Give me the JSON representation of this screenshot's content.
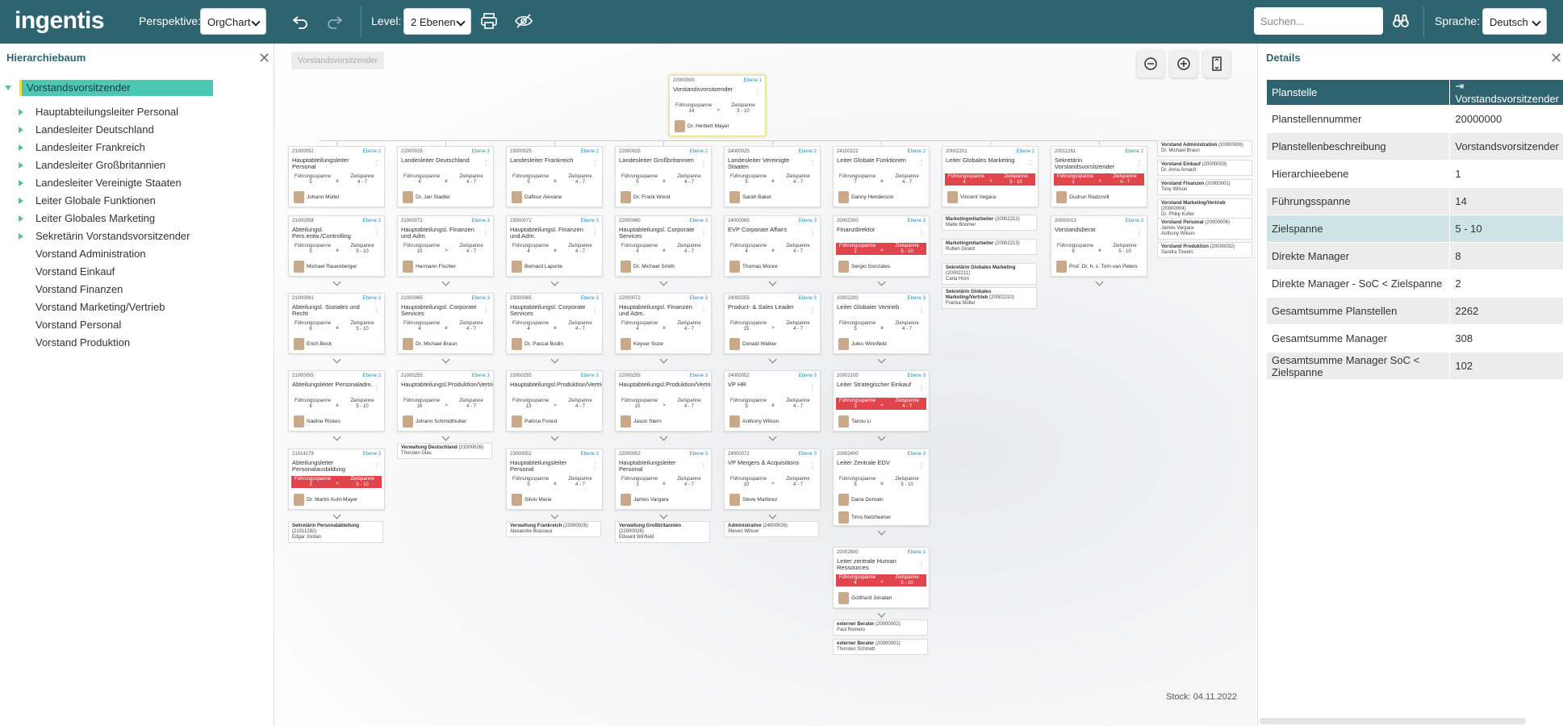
{
  "topbar": {
    "logo": "ingentis",
    "perspective_label": "Perspektive:",
    "perspective_value": "OrgChart",
    "level_label": "Level:",
    "level_value": "2 Ebenen",
    "search_placeholder": "Suchen...",
    "language_label": "Sprache:",
    "language_value": "Deutsch",
    "bg_color": "#2e6470"
  },
  "left_panel": {
    "title": "Hierarchiebaum",
    "root": "Vorstandsvorsitzender",
    "items": [
      {
        "label": "Hauptabteilungsleiter Personal",
        "expandable": true
      },
      {
        "label": "Landesleiter Deutschland",
        "expandable": true
      },
      {
        "label": "Landesleiter Frankreich",
        "expandable": true
      },
      {
        "label": "Landesleiter Großbritannien",
        "expandable": true
      },
      {
        "label": "Landesleiter Vereinigte Staaten",
        "expandable": true
      },
      {
        "label": "Leiter Globale Funktionen",
        "expandable": true
      },
      {
        "label": "Leiter Globales Marketing",
        "expandable": true
      },
      {
        "label": "Sekretärin Vorstandsvorsitzender",
        "expandable": true
      },
      {
        "label": "Vorstand Administration",
        "expandable": false
      },
      {
        "label": "Vorstand Einkauf",
        "expandable": false
      },
      {
        "label": "Vorstand Finanzen",
        "expandable": false
      },
      {
        "label": "Vorstand Marketing/Vertrieb",
        "expandable": false
      },
      {
        "label": "Vorstand Personal",
        "expandable": false
      },
      {
        "label": "Vorstand Produktion",
        "expandable": false
      }
    ]
  },
  "canvas": {
    "breadcrumb": "Vorstandsvorsitzender",
    "stock": "Stock: 04.11.2022",
    "root_card": {
      "id": "20000000",
      "level": "Ebene 1",
      "title": "Vorstandsvorsitzender",
      "span_label": "Führungsspanne",
      "target_label": "Zielspanne",
      "span": "14",
      "op": ">",
      "target": "5 - 10",
      "person": "Dr. Herbert Mayer"
    },
    "columns": [
      {
        "cards": [
          {
            "id": "21000052",
            "level": "Ebene 2",
            "title": "Hauptabteilungsleiter Personal",
            "span": "5",
            "op": "e",
            "target": "4 - 7",
            "person": "Johann Müller",
            "red": false
          },
          {
            "id": "21000058",
            "level": "Ebene 3",
            "title": "Abteilungsl. Pers.entw./Controlling",
            "span": "5",
            "op": "e",
            "target": "5 - 10",
            "person": "Michael Rauenberger",
            "red": false
          },
          {
            "id": "21000061",
            "level": "Ebene 3",
            "title": "Abteilungsl. Soziales und Recht",
            "span": "6",
            "op": "e",
            "target": "5 - 10",
            "person": "Erich Beck",
            "red": false
          },
          {
            "id": "21000055",
            "level": "Ebene 3",
            "title": "Abteilungsleiter Personaladm.",
            "span": "8",
            "op": "e",
            "target": "5 - 10",
            "person": "Nadine Rickes",
            "red": false
          },
          {
            "id": "21014179",
            "level": "Ebene 3",
            "title": "Abteilungsleiter Personalausbildung",
            "span": "2",
            "op": "<",
            "target": "5 - 10",
            "person": "Dr. Martin Kuhl-Mayer",
            "red": true
          }
        ],
        "minis": [
          {
            "title": "Sekretärin Personalabteilung",
            "id": "(21011282)",
            "person": "Edgar Jordan"
          }
        ]
      },
      {
        "cards": [
          {
            "id": "21000025",
            "level": "Ebene 2",
            "title": "Landesleiter Deutschland",
            "span": "4",
            "op": "e",
            "target": "4 - 7",
            "person": "Dr. Jan Stadler",
            "red": false
          },
          {
            "id": "21000072",
            "level": "Ebene 3",
            "title": "Hauptabteilungsl. Finanzen und Adm.",
            "span": "10",
            "op": ">",
            "target": "4 - 7",
            "person": "Hermann Fischer",
            "red": false
          },
          {
            "id": "21000065",
            "level": "Ebene 3",
            "title": "Hauptabteilungsl. Corporate Services",
            "span": "4",
            "op": "e",
            "target": "4 - 7",
            "person": "Dr. Michael Braun",
            "red": false
          },
          {
            "id": "21000255",
            "level": "Ebene 3",
            "title": "Hauptabteilungsl.Produktion/Vertrieb",
            "span": "16",
            "op": ">",
            "target": "4 - 7",
            "person": "Johann Schmidthuber",
            "red": false
          }
        ],
        "minis": [
          {
            "title": "Verwaltung Deutschland",
            "id": "(21000026)",
            "person": "Thorsten Glas"
          }
        ]
      },
      {
        "cards": [
          {
            "id": "23000025",
            "level": "Ebene 2",
            "title": "Landesleiter Frankreich",
            "span": "5",
            "op": "e",
            "target": "4 - 7",
            "person": "Daftour Alexane",
            "red": false
          },
          {
            "id": "23000072",
            "level": "Ebene 3",
            "title": "Hauptabteilungsl. Finanzen und Adm.",
            "span": "4",
            "op": "e",
            "target": "4 - 7",
            "person": "Bernard Laporte",
            "red": false
          },
          {
            "id": "23000065",
            "level": "Ebene 3",
            "title": "Hauptabteilungsl. Corporate Services",
            "span": "4",
            "op": "e",
            "target": "4 - 7",
            "person": "Dr. Pascal Bodin",
            "red": false
          },
          {
            "id": "23000255",
            "level": "Ebene 3",
            "title": "Hauptabteilungsl.Produktion/Vertrieb",
            "span": "13",
            "op": ">",
            "target": "4 - 7",
            "person": "Patrice Forest",
            "red": false
          },
          {
            "id": "23000052",
            "level": "Ebene 3",
            "title": "Hauptabteilungsleiter Personal",
            "span": "5",
            "op": "e",
            "target": "4 - 7",
            "person": "Silvio Marie",
            "red": false
          }
        ],
        "minis": [
          {
            "title": "Verwaltung Frankreich",
            "id": "(23000026)",
            "person": "Alexandre Brasseur"
          }
        ]
      },
      {
        "cards": [
          {
            "id": "22000025",
            "level": "Ebene 2",
            "title": "Landesleiter Großbritannien",
            "span": "5",
            "op": "e",
            "target": "4 - 7",
            "person": "Dr. Frank Wood",
            "red": false
          },
          {
            "id": "22000060",
            "level": "Ebene 3",
            "title": "Hauptabteilungsl. Corporate Services",
            "span": "4",
            "op": "e",
            "target": "4 - 7",
            "person": "Dr. Michael Smith",
            "red": false
          },
          {
            "id": "22000072",
            "level": "Ebene 3",
            "title": "Hauptabteilungsl. Finanzen und Adm.",
            "span": "4",
            "op": "e",
            "target": "4 - 7",
            "person": "Keyser Soze",
            "red": false
          },
          {
            "id": "22000255",
            "level": "Ebene 3",
            "title": "Hauptabteilungsl.Produktion/Vertrieb",
            "span": "10",
            "op": ">",
            "target": "4 - 7",
            "person": "Jason Stern",
            "red": false
          },
          {
            "id": "22000052",
            "level": "Ebene 3",
            "title": "Hauptabteilungsleiter Personal",
            "span": "3",
            "op": "e",
            "target": "4 - 7",
            "person": "James Vargara",
            "red": false
          }
        ],
        "minis": [
          {
            "title": "Verwaltung Großbritannien",
            "id": "(22000026)",
            "person": "Edward Winfield"
          }
        ]
      },
      {
        "cards": [
          {
            "id": "24000025",
            "level": "Ebene 2",
            "title": "Landesleiter Vereinigte Staaten",
            "span": "5",
            "op": "e",
            "target": "4 - 7",
            "person": "Sarah Baker",
            "red": false
          },
          {
            "id": "24000065",
            "level": "Ebene 3",
            "title": "EVP Corporate Affairs",
            "span": "4",
            "op": "e",
            "target": "4 - 7",
            "person": "Thomas Moore",
            "red": false
          },
          {
            "id": "24000255",
            "level": "Ebene 3",
            "title": "Product- & Sales Leader",
            "span": "15",
            "op": ">",
            "target": "4 - 7",
            "person": "Donald Walker",
            "red": false
          },
          {
            "id": "24000052",
            "level": "Ebene 3",
            "title": "VP HR",
            "span": "5",
            "op": "e",
            "target": "4 - 7",
            "person": "Anthony Wilson",
            "red": false
          },
          {
            "id": "24000072",
            "level": "Ebene 3",
            "title": "VP Mergers & Acquisitions",
            "span": "10",
            "op": ">",
            "target": "4 - 7",
            "person": "Steve Martinez",
            "red": false
          }
        ],
        "minis": [
          {
            "title": "Administrative",
            "id": "(24000026)",
            "person": "Steven Wilson"
          }
        ]
      },
      {
        "cards": [
          {
            "id": "24100222",
            "level": "Ebene 2",
            "title": "Leiter Globale Funktionen",
            "span": "7",
            "op": "e",
            "target": "4 - 7",
            "person": "Danny Henderson",
            "red": false
          },
          {
            "id": "20002300",
            "level": "Ebene 3",
            "title": "Finanzdirektor",
            "span": "2",
            "op": "<",
            "target": "5 - 10",
            "person": "Sergio Gonzales",
            "red": true
          },
          {
            "id": "20002200",
            "level": "Ebene 3",
            "title": "Leiter Globaler Vertrieb",
            "span": "5",
            "op": "e",
            "target": "4 - 7",
            "person": "Jules Winnfield",
            "red": false
          },
          {
            "id": "20002100",
            "level": "Ebene 3",
            "title": "Leiter Strategischer Einkauf",
            "span": "3",
            "op": "<",
            "target": "4 - 7",
            "person": "Tanou Li",
            "red": true
          },
          {
            "id": "20002400",
            "level": "Ebene 3",
            "title": "Leiter Zentrale EDV",
            "span": "5",
            "op": "e",
            "target": "5 - 10",
            "person": "Dana Domain",
            "person2": "Timo Netzheimer",
            "red": false
          },
          {
            "id": "20002500",
            "level": "Ebene 3",
            "title": "Leiter zentrale Human Ressources",
            "span": "4",
            "op": "<",
            "target": "5 - 10",
            "person": "Gotthard Jonatan",
            "red": true
          }
        ],
        "minis": [
          {
            "title": "externer Berater",
            "id": "(20000002)",
            "person": "Paul Romero"
          },
          {
            "title": "externer Berater",
            "id": "(20000001)",
            "person": "Thorsten Schmidt"
          }
        ]
      },
      {
        "cards": [
          {
            "id": "20002201",
            "level": "Ebene 2",
            "title": "Leiter Globales Marketing",
            "span": "4",
            "op": "<",
            "target": "5 - 10",
            "person": "Vincent Vegara",
            "red": true
          }
        ],
        "minis": [
          {
            "title": "Marketingmitarbeiter",
            "id": "(20002212)",
            "person": "Malte Boomer"
          },
          {
            "title": "Marketingmitarbeiter",
            "id": "(20002213)",
            "person": "Ruben Girard"
          },
          {
            "title": "Sekretärin Globales Marketing",
            "id": "(20002211)",
            "person": "Carla Horn"
          },
          {
            "title": "Sekretärin Globales Marketing/Vertrieb",
            "id": "(20002210)",
            "person": "Franka Müller"
          }
        ]
      },
      {
        "cards": [
          {
            "id": "20011261",
            "level": "Ebene 2",
            "title": "Sekretärin Vorstandsvorsitzender",
            "span": "1",
            "op": "<",
            "target": "4 - 7",
            "person": "Gudrun Radzcvill",
            "red": true
          },
          {
            "id": "20000013",
            "level": "Ebene 3",
            "title": "Vorstandsberat",
            "span": "6",
            "op": "e",
            "target": "5 - 10",
            "person": "Prof. Dr. h. c. Tom van Peters",
            "red": false
          }
        ],
        "minis": []
      }
    ],
    "staff": [
      {
        "title": "Vorstand Administration",
        "id": "(20000006)",
        "person": "Dr. Michael Braun"
      },
      {
        "title": "Vorstand Einkauf",
        "id": "(20000003)",
        "person": "Dr. Anna Arnault"
      },
      {
        "title": "Vorstand Finanzen",
        "id": "(20000001)",
        "person": "Tony Wilson"
      },
      {
        "title": "Vorstand Marketing/Vertrieb",
        "id": "(20000004)",
        "person": "Dr. Philip Kotler"
      },
      {
        "title": "Vorstand Personal",
        "id": "(20000006)",
        "person": "James Vargara",
        "person2": "Anthony Wilson"
      },
      {
        "title": "Vorstand Produktion",
        "id": "(20000002)",
        "person": "Sandra Towers"
      }
    ]
  },
  "details": {
    "title": "Details",
    "header_key": "Planstelle",
    "header_value": "Vorstandsvorsitzender",
    "rows": [
      {
        "key": "Planstellennummer",
        "value": "20000000"
      },
      {
        "key": "Planstellenbeschreibung",
        "value": "Vorstandsvorsitzender"
      },
      {
        "key": "Hierarchieebene",
        "value": "1"
      },
      {
        "key": "Führungsspanne",
        "value": "14"
      },
      {
        "key": "Zielspanne",
        "value": "5 - 10"
      },
      {
        "key": "Direkte Manager",
        "value": "8"
      },
      {
        "key": "Direkte Manager - SoC < Zielspanne",
        "value": "2"
      },
      {
        "key": "Gesamtsumme Planstellen",
        "value": "2262"
      },
      {
        "key": "Gesamtsumme Manager",
        "value": "308"
      },
      {
        "key": "Gesamtsumme Manager SoC < Zielspanne",
        "value": "102"
      }
    ]
  }
}
